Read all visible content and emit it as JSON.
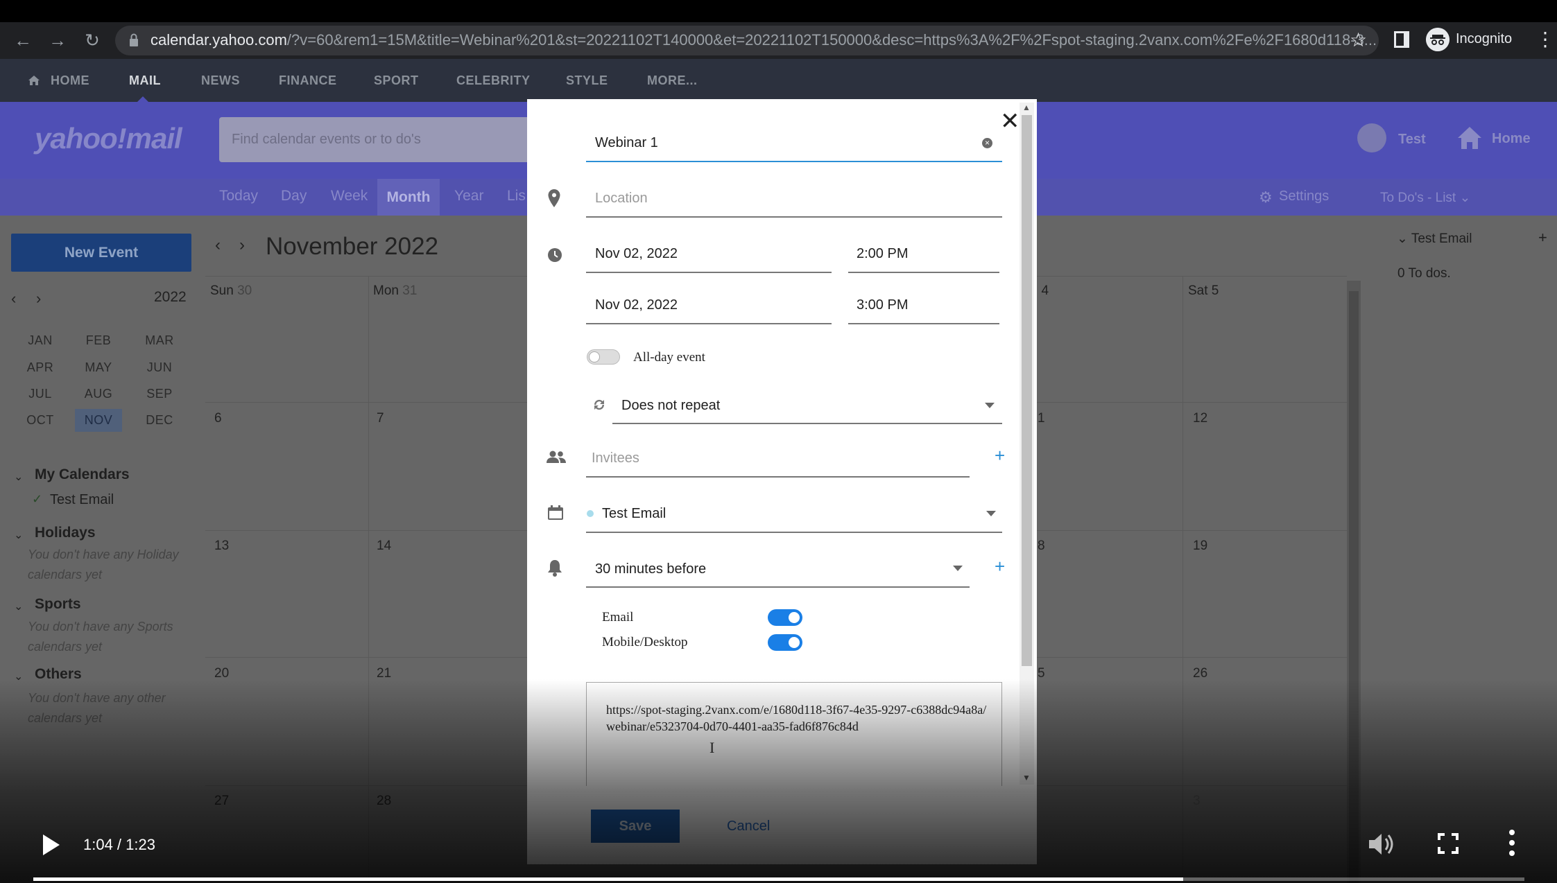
{
  "browser": {
    "url_host": "calendar.yahoo.com",
    "url_rest": "/?v=60&rem1=15M&title=Webinar%201&st=20221102T140000&et=20221102T150000&desc=https%3A%2F%2Fspot-staging.2vanx.com%2Fe%2F1680d118-3...",
    "profile": "Incognito"
  },
  "ynav": {
    "items": [
      "HOME",
      "MAIL",
      "NEWS",
      "FINANCE",
      "SPORT",
      "CELEBRITY",
      "STYLE",
      "MORE..."
    ]
  },
  "header": {
    "logo": "yahoo!mail",
    "search_placeholder": "Find calendar events or to do's",
    "user": "Test",
    "home": "Home"
  },
  "tabs": {
    "items": [
      "Today",
      "Day",
      "Week",
      "Month",
      "Year",
      "Lis"
    ],
    "active": "Month",
    "settings": "Settings",
    "todo_list": "To Do's - List"
  },
  "sidebar": {
    "new_event": "New Event",
    "year": "2022",
    "months": [
      "JAN",
      "FEB",
      "MAR",
      "APR",
      "MAY",
      "JUN",
      "JUL",
      "AUG",
      "SEP",
      "OCT",
      "NOV",
      "DEC"
    ],
    "selected_month": "NOV",
    "sections": {
      "my_calendars": "My Calendars",
      "test_email": "Test Email",
      "holidays": "Holidays",
      "holidays_empty": "You don't have any Holiday calendars yet",
      "sports": "Sports",
      "sports_empty": "You don't have any Sports calendars yet",
      "others": "Others",
      "others_empty": "You don't have any other calendars yet"
    }
  },
  "calendar": {
    "title": "November 2022",
    "heads": {
      "sun": "Sun",
      "sun_d": "30",
      "mon": "Mon",
      "mon_d": "31",
      "fri_d": "i 4",
      "sat": "Sat 5"
    },
    "days": {
      "r1_sun": "6",
      "r1_mon": "7",
      "r1_fri": "1",
      "r1_sat": "12",
      "r2_sun": "13",
      "r2_mon": "14",
      "r2_fri": "8",
      "r2_sat": "19",
      "r3_sun": "20",
      "r3_mon": "21",
      "r3_fri": "5",
      "r3_sat": "26",
      "r4_sun": "27",
      "r4_mon": "28",
      "r4_sat": "3"
    }
  },
  "todo": {
    "heading": "Test Email",
    "count": "0 To dos."
  },
  "modal": {
    "title_value": "Webinar 1",
    "location_placeholder": "Location",
    "start_date": "Nov 02, 2022",
    "start_time": "2:00 PM",
    "end_date": "Nov 02, 2022",
    "end_time": "3:00 PM",
    "all_day": "All-day event",
    "repeat": "Does not repeat",
    "invitees_placeholder": "Invitees",
    "calendar": "Test Email",
    "calendar_dot_color": "#a8dcec",
    "reminder": "30 minutes before",
    "email_label": "Email",
    "mobile_label": "Mobile/Desktop",
    "description": "https://spot-staging.2vanx.com/e/1680d118-3f67-4e35-9297-c6388dc94a8a/webinar/e5323704-0d70-4401-aa35-fad6f876c84d",
    "save": "Save",
    "cancel": "Cancel"
  },
  "video": {
    "time": "1:04 / 1:23",
    "progress": 0.771
  },
  "colors": {
    "accent": "#1a7fe6",
    "save": "#1f60b0",
    "header": "#4f4fb5"
  }
}
